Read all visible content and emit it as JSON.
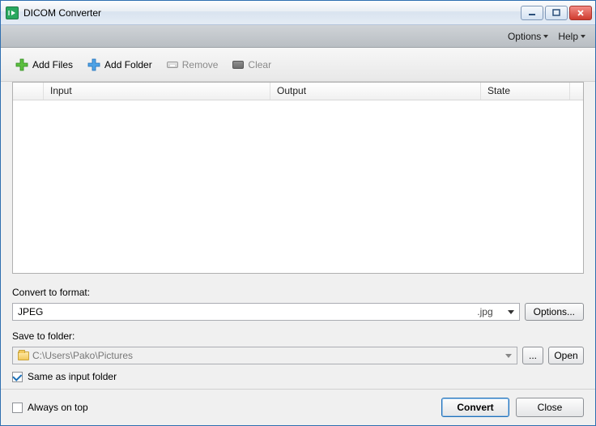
{
  "window": {
    "title": "DICOM Converter"
  },
  "menubar": {
    "options": "Options",
    "help": "Help"
  },
  "toolbar": {
    "add_files": "Add Files",
    "add_folder": "Add Folder",
    "remove": "Remove",
    "clear": "Clear"
  },
  "list": {
    "headers": {
      "input": "Input",
      "output": "Output",
      "state": "State"
    }
  },
  "format": {
    "label": "Convert to format:",
    "value": "JPEG",
    "ext": ".jpg",
    "options_btn": "Options..."
  },
  "save": {
    "label": "Save to folder:",
    "path": "C:\\Users\\Pako\\Pictures",
    "browse_btn": "...",
    "open_btn": "Open",
    "same_as_input": "Same as input folder",
    "same_as_input_checked": true
  },
  "footer": {
    "always_on_top": "Always on top",
    "always_on_top_checked": false,
    "convert": "Convert",
    "close": "Close"
  }
}
